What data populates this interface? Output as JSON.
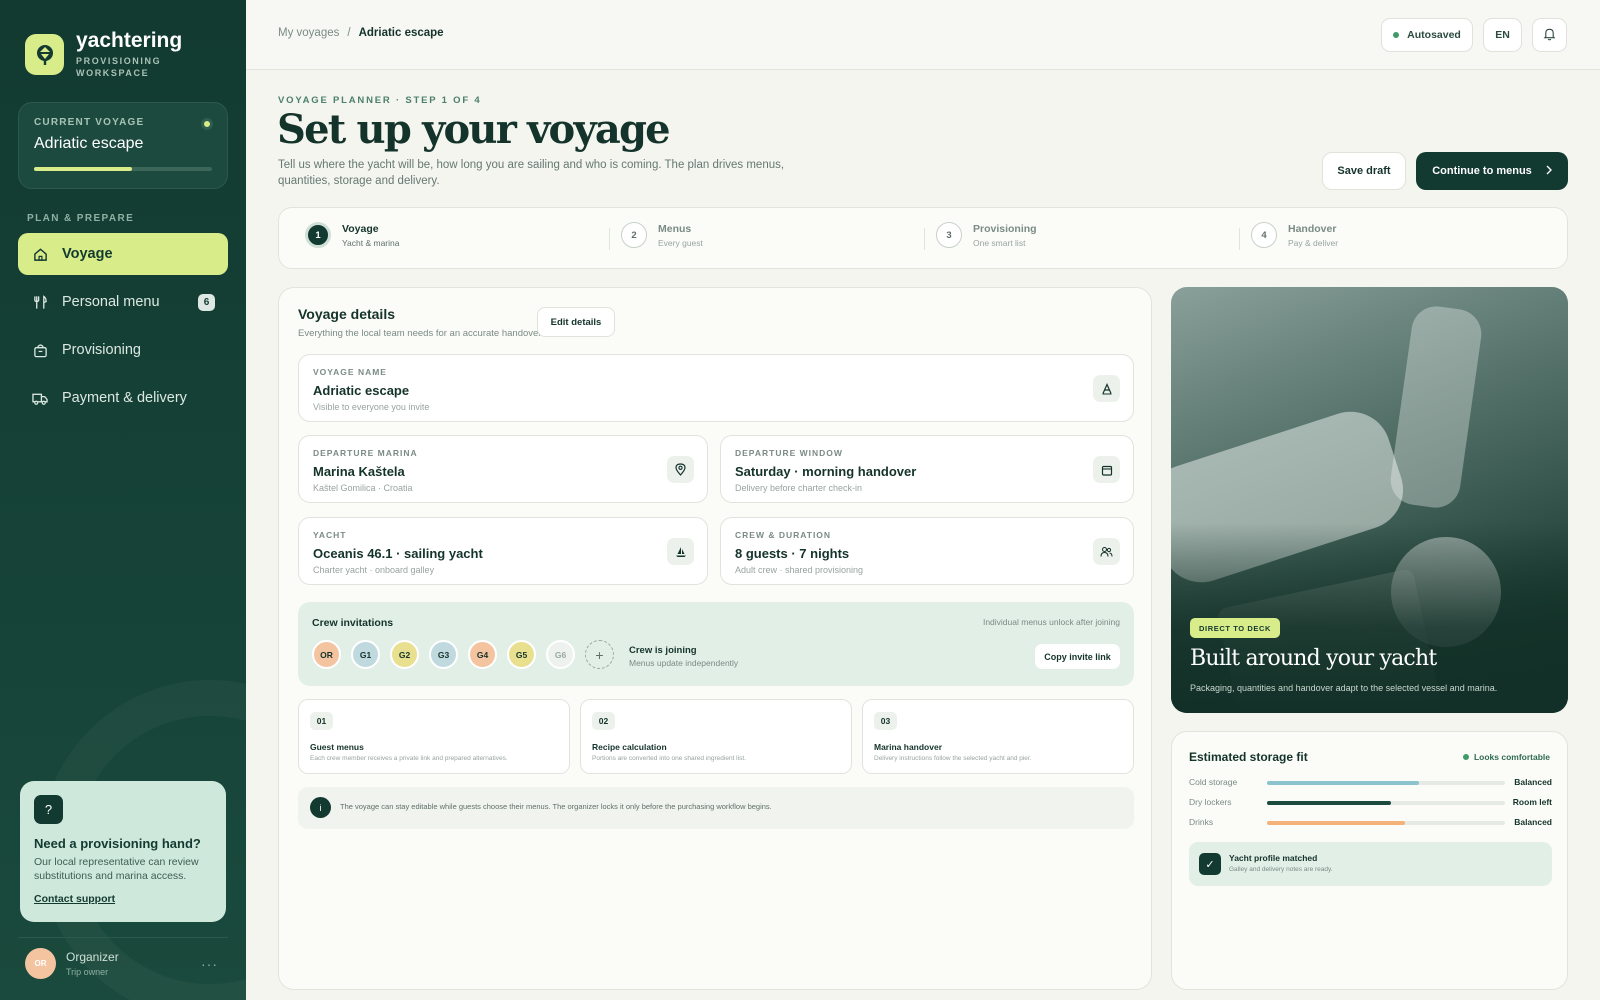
{
  "brand": {
    "name": "yachtering",
    "subtitle_line1": "PROVISIONING",
    "subtitle_line2": "WORKSPACE"
  },
  "current_voyage": {
    "label": "CURRENT VOYAGE",
    "name": "Adriatic escape",
    "progress": 0.55
  },
  "nav": {
    "section": "PLAN & PREPARE",
    "items": [
      {
        "label": "Voyage",
        "icon": "home-icon",
        "active": true
      },
      {
        "label": "Personal menu",
        "icon": "utensils-icon",
        "badge": "6"
      },
      {
        "label": "Provisioning",
        "icon": "bag-icon"
      },
      {
        "label": "Payment & delivery",
        "icon": "truck-icon"
      }
    ]
  },
  "help": {
    "icon": "?",
    "title": "Need a provisioning hand?",
    "text": "Our local representative can review substitutions and marina access.",
    "link": "Contact support"
  },
  "user": {
    "initials": "OR",
    "name": "Organizer",
    "role": "Trip owner"
  },
  "topbar": {
    "breadcrumb": [
      "My voyages",
      "Adriatic escape"
    ],
    "separator": "/",
    "autosaved": "Autosaved",
    "language": "EN"
  },
  "header": {
    "eyebrow": "VOYAGE PLANNER · STEP 1 OF 4",
    "title": "Set up your voyage",
    "lede": "Tell us where the yacht will be, how long you are sailing and who is coming. The plan drives menus, quantities, storage and delivery.",
    "save_draft": "Save draft",
    "continue": "Continue to menus"
  },
  "steps": [
    {
      "num": "1",
      "title": "Voyage",
      "sub": "Yacht & marina",
      "active": true
    },
    {
      "num": "2",
      "title": "Menus",
      "sub": "Every guest"
    },
    {
      "num": "3",
      "title": "Provisioning",
      "sub": "One smart list"
    },
    {
      "num": "4",
      "title": "Handover",
      "sub": "Pay & deliver"
    }
  ],
  "details": {
    "title": "Voyage details",
    "subtitle": "Everything the local team needs for an accurate handover.",
    "edit": "Edit details",
    "fields": {
      "name": {
        "label": "VOYAGE NAME",
        "value": "Adriatic escape",
        "hint": "Visible to everyone you invite",
        "icon": "pen-icon"
      },
      "marina": {
        "label": "DEPARTURE MARINA",
        "value": "Marina Kaštela",
        "hint": "Kaštel Gomilica · Croatia",
        "icon": "pin-icon"
      },
      "window": {
        "label": "DEPARTURE WINDOW",
        "value": "Saturday · morning handover",
        "hint": "Delivery before charter check-in",
        "icon": "calendar-icon"
      },
      "yacht": {
        "label": "YACHT",
        "value": "Oceanis 46.1 · sailing yacht",
        "hint": "Charter yacht · onboard galley",
        "icon": "sailboat-icon"
      },
      "crew": {
        "label": "CREW & DURATION",
        "value": "8 guests · 7 nights",
        "hint": "Adult crew · shared provisioning",
        "icon": "people-icon"
      }
    },
    "crew": {
      "title": "Crew invitations",
      "note": "Individual menus unlock after joining",
      "avatars": [
        {
          "initials": "OR",
          "color": "#f4c4a0"
        },
        {
          "initials": "G1",
          "color": "#bfd9df"
        },
        {
          "initials": "G2",
          "color": "#e8e08f"
        },
        {
          "initials": "G3",
          "color": "#bfd9df"
        },
        {
          "initials": "G4",
          "color": "#f4c4a0"
        },
        {
          "initials": "G5",
          "color": "#e8e08f"
        },
        {
          "initials": "G6",
          "color": "#eef2ee"
        }
      ],
      "add": "+",
      "joining_title": "Crew is joining",
      "joining_sub": "Menus update independently",
      "copy": "Copy invite link"
    },
    "features": [
      {
        "num": "01",
        "title": "Guest menus",
        "text": "Each crew member receives a private link and prepared alternatives."
      },
      {
        "num": "02",
        "title": "Recipe calculation",
        "text": "Portions are converted into one shared ingredient list."
      },
      {
        "num": "03",
        "title": "Marina handover",
        "text": "Delivery instructions follow the selected yacht and pier."
      }
    ],
    "note_icon": "i",
    "note": "The voyage can stay editable while guests choose their menus. The organizer locks it only before the purchasing workflow begins."
  },
  "photo": {
    "tag": "DIRECT TO DECK",
    "title": "Built around your yacht",
    "text": "Packaging, quantities and handover adapt to the selected vessel and marina."
  },
  "storage": {
    "title": "Estimated storage fit",
    "status": "Looks comfortable",
    "rows": [
      {
        "label": "Cold storage",
        "value": "Balanced",
        "level": 0.64,
        "color": "#8cc3cf"
      },
      {
        "label": "Dry lockers",
        "value": "Room left",
        "level": 0.52,
        "color": "#1d4a3e"
      },
      {
        "label": "Drinks",
        "value": "Balanced",
        "level": 0.58,
        "color": "#f2b27a"
      }
    ],
    "match_title": "Yacht profile matched",
    "match_sub": "Galley and delivery notes are ready.",
    "check": "✓"
  },
  "colors": {
    "brand_dark": "#123a30",
    "accent": "#d9ec8a",
    "mint": "#e1efe7"
  }
}
